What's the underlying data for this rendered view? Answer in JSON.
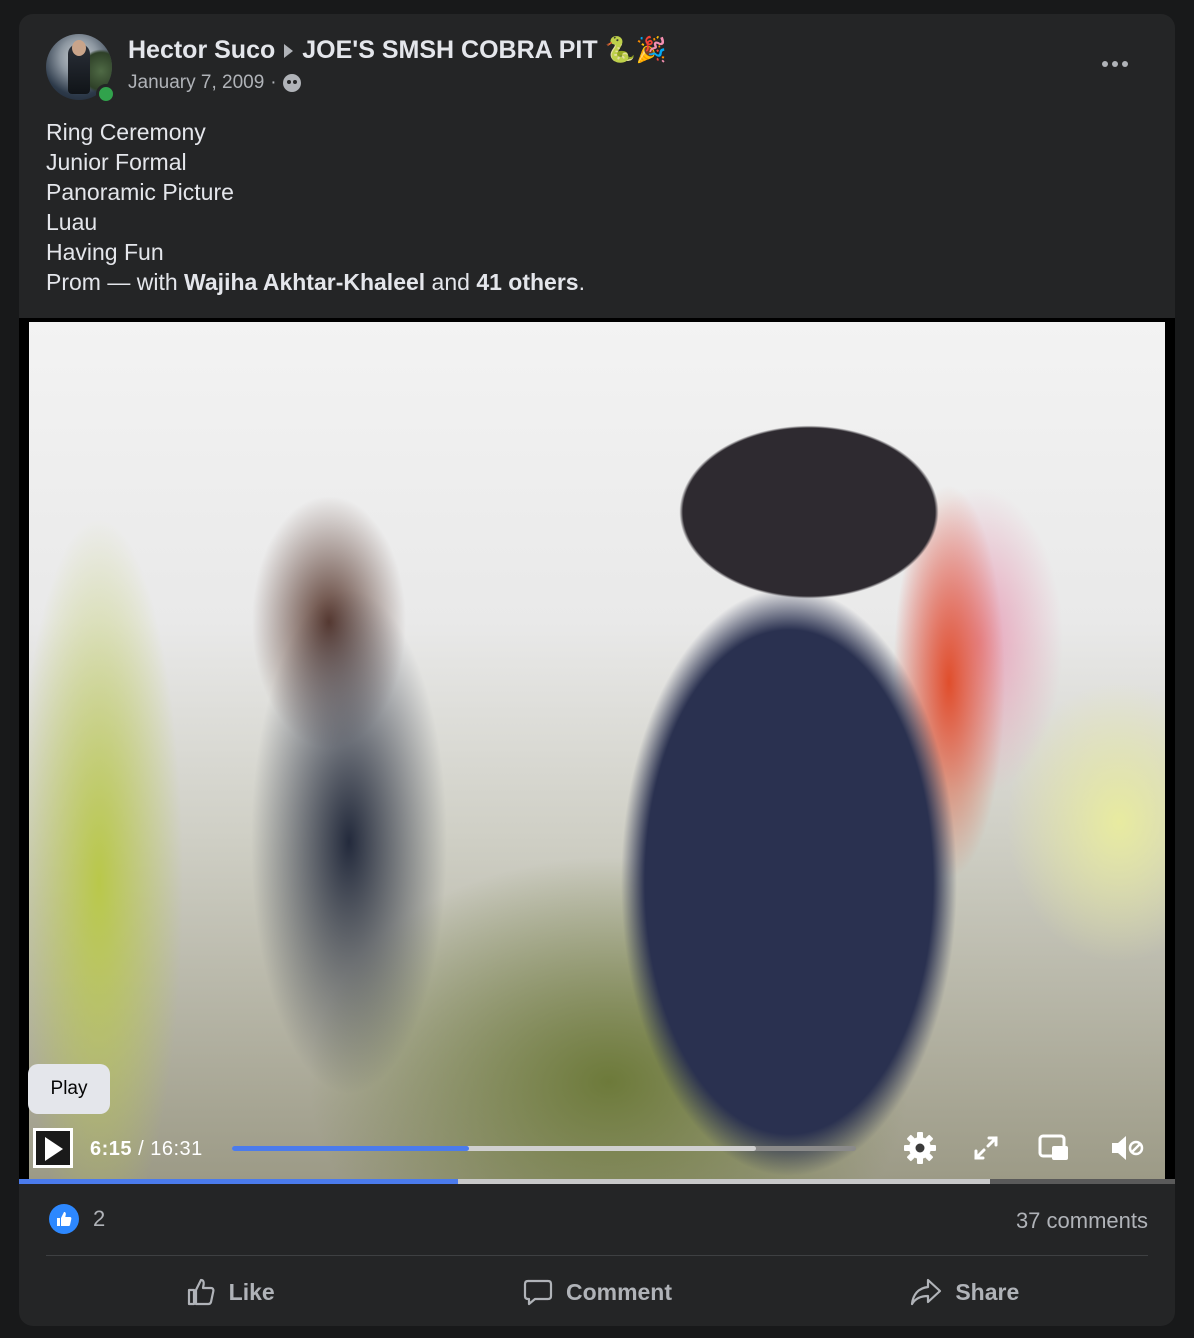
{
  "post": {
    "author": "Hector Suco",
    "group": "JOE'S SMSH COBRA PIT",
    "group_emoji": "🐍🎉",
    "date": "January 7, 2009",
    "separator": "·",
    "lines": [
      "Ring Ceremony",
      "Junior Formal",
      "Panoramic Picture",
      "Luau",
      "Having Fun"
    ],
    "last_line_prefix": "Prom — with ",
    "tagged_person": "Wajiha Akhtar-Khaleel",
    "tagged_and": " and ",
    "tagged_others": "41 others",
    "last_line_suffix": "."
  },
  "video": {
    "tooltip": "Play",
    "current_time": "6:15",
    "time_separator": " / ",
    "duration": "16:31",
    "progress_fraction": 0.38,
    "buffered_fraction": 0.84
  },
  "stats": {
    "likes": "2",
    "comments": "37 comments"
  },
  "actions": {
    "like": "Like",
    "comment": "Comment",
    "share": "Share"
  },
  "colors": {
    "card_bg": "#242526",
    "page_bg": "#18191a",
    "accent": "#4b7bec",
    "like_blue": "#2d88ff",
    "online_green": "#31a24c"
  },
  "icons": [
    "more-icon",
    "audience-icon",
    "play-icon",
    "settings-icon",
    "fullscreen-icon",
    "pip-icon",
    "volume-icon",
    "like-reaction-icon",
    "like-icon",
    "comment-icon",
    "share-icon"
  ]
}
